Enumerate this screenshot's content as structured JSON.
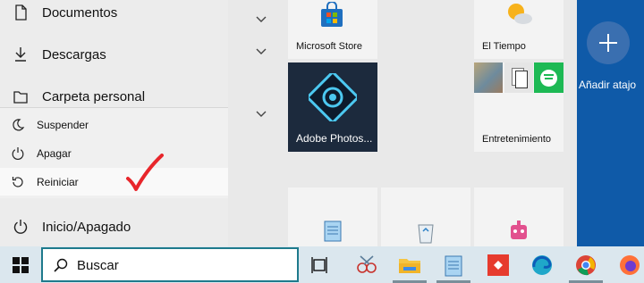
{
  "left_menu": {
    "items": [
      {
        "label": "Documentos",
        "icon": "document-icon"
      },
      {
        "label": "Descargas",
        "icon": "download-icon"
      },
      {
        "label": "Carpeta personal",
        "icon": "folder-icon"
      }
    ],
    "power_label": "Inicio/Apagado"
  },
  "power_menu": {
    "items": [
      {
        "label": "Suspender",
        "icon": "moon-icon"
      },
      {
        "label": "Apagar",
        "icon": "power-icon"
      },
      {
        "label": "Reiniciar",
        "icon": "restart-icon"
      }
    ]
  },
  "tiles": {
    "microsoft_store": "Microsoft Store",
    "weather": "El Tiempo",
    "adobe": "Adobe Photos...",
    "entertainment": "Entretenimiento"
  },
  "right_panel": {
    "add_label": "Añadir atajo"
  },
  "taskbar": {
    "search_placeholder": "Buscar"
  },
  "colors": {
    "accent": "#0f5aa8",
    "annotation": "#e8262b"
  }
}
